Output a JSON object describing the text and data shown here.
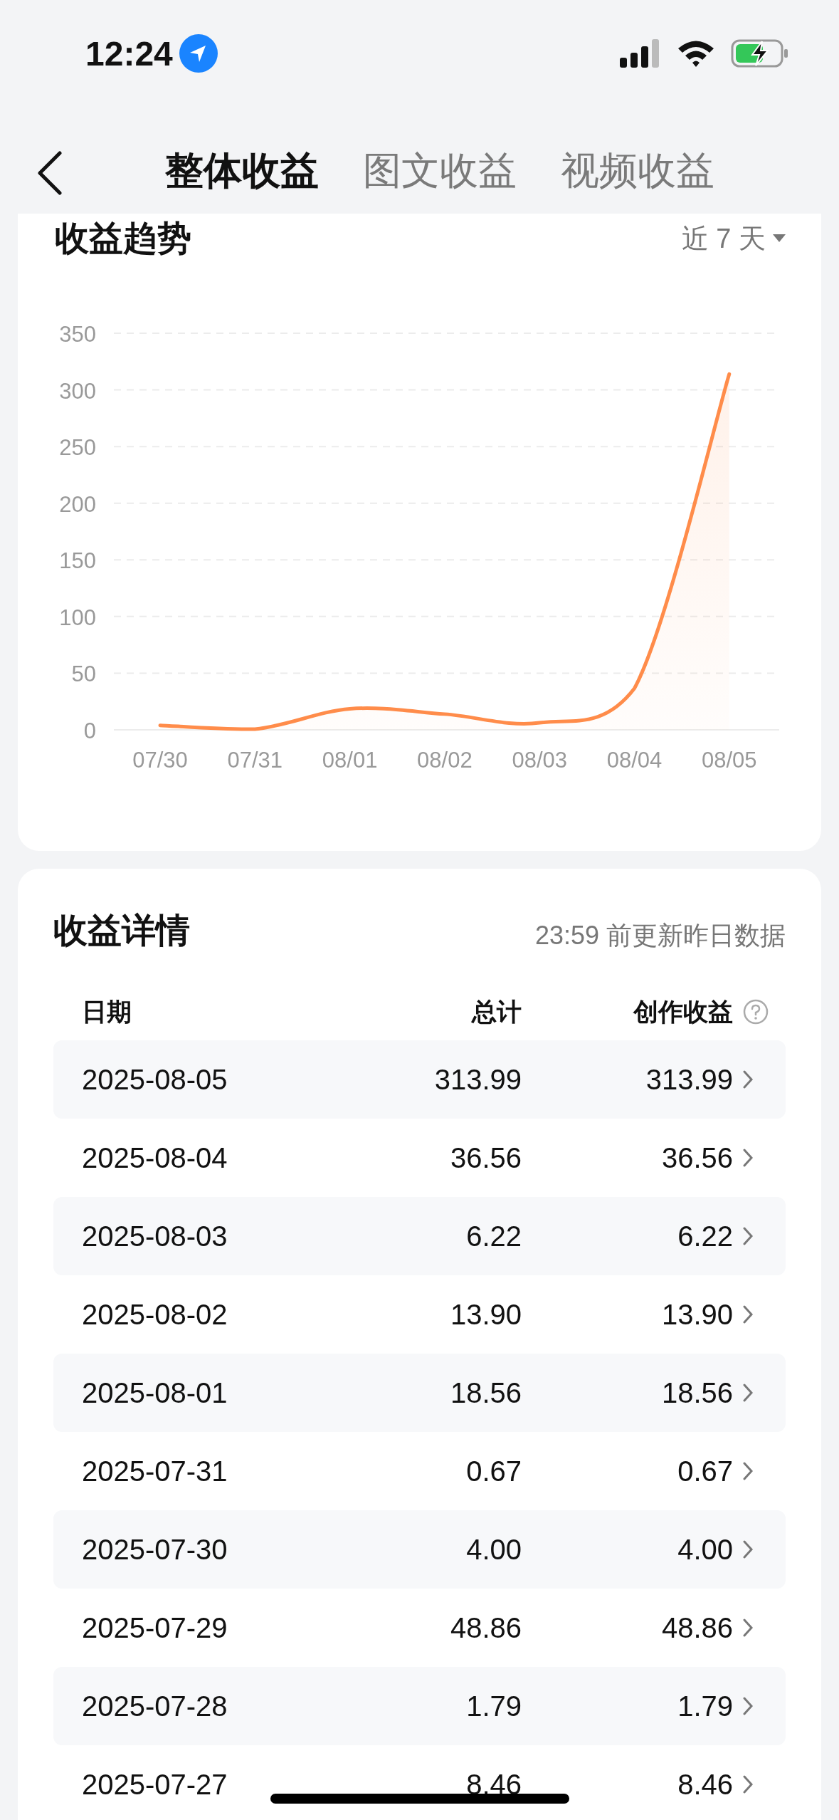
{
  "status_bar": {
    "time": "12:24"
  },
  "tabs": [
    {
      "label": "整体收益",
      "selected": true
    },
    {
      "label": "图文收益",
      "selected": false
    },
    {
      "label": "视频收益",
      "selected": false
    }
  ],
  "trend": {
    "title": "收益趋势",
    "range": "近 7 天",
    "chart_data": {
      "type": "line",
      "categories": [
        "07/30",
        "07/31",
        "08/01",
        "08/02",
        "08/03",
        "08/04",
        "08/05"
      ],
      "series": [
        {
          "color": "#ff8c4a",
          "values": [
            4.0,
            0.67,
            18.56,
            13.9,
            6.22,
            36.56,
            313.99
          ]
        }
      ],
      "grid": true,
      "ylim": [
        0,
        350
      ],
      "yticks": [
        0,
        50,
        100,
        150,
        200,
        250,
        300,
        350
      ]
    }
  },
  "details": {
    "title": "收益详情",
    "note": "23:59 前更新昨日数据",
    "columns": [
      "日期",
      "总计",
      "创作收益"
    ],
    "rows": [
      {
        "date": "2025-08-05",
        "total": "313.99",
        "creation": "313.99"
      },
      {
        "date": "2025-08-04",
        "total": "36.56",
        "creation": "36.56"
      },
      {
        "date": "2025-08-03",
        "total": "6.22",
        "creation": "6.22"
      },
      {
        "date": "2025-08-02",
        "total": "13.90",
        "creation": "13.90"
      },
      {
        "date": "2025-08-01",
        "total": "18.56",
        "creation": "18.56"
      },
      {
        "date": "2025-07-31",
        "total": "0.67",
        "creation": "0.67"
      },
      {
        "date": "2025-07-30",
        "total": "4.00",
        "creation": "4.00"
      },
      {
        "date": "2025-07-29",
        "total": "48.86",
        "creation": "48.86"
      },
      {
        "date": "2025-07-28",
        "total": "1.79",
        "creation": "1.79"
      },
      {
        "date": "2025-07-27",
        "total": "8.46",
        "creation": "8.46"
      }
    ]
  }
}
